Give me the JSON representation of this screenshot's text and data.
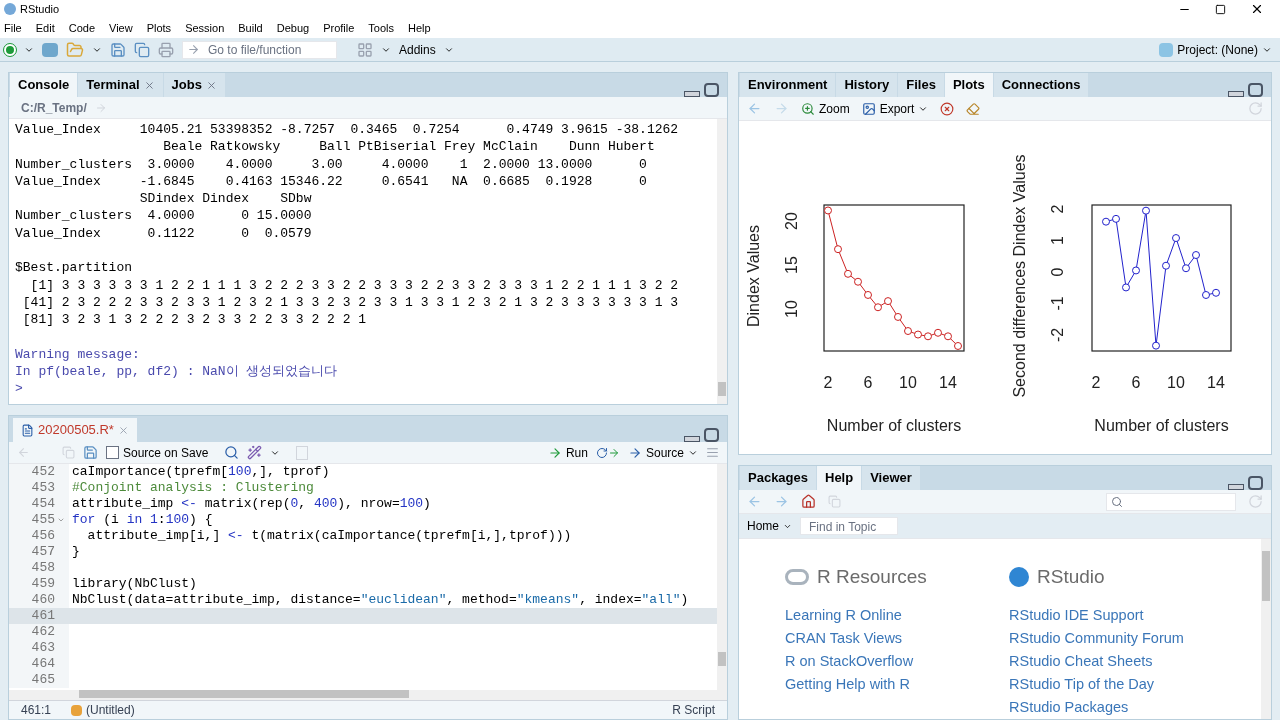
{
  "window": {
    "title": "RStudio"
  },
  "menu": [
    "File",
    "Edit",
    "Code",
    "View",
    "Plots",
    "Session",
    "Build",
    "Debug",
    "Profile",
    "Tools",
    "Help"
  ],
  "toolbar": {
    "goto_placeholder": "Go to file/function",
    "addins": "Addins",
    "project": "Project: (None)"
  },
  "console": {
    "tabs": [
      {
        "label": "Console",
        "selected": true,
        "closable": false
      },
      {
        "label": "Terminal",
        "selected": false,
        "closable": true
      },
      {
        "label": "Jobs",
        "selected": false,
        "closable": true
      }
    ],
    "path": "C:/R_Temp/",
    "lines": [
      {
        "kind": "output",
        "text": "Value_Index     10405.21 53398352 -8.7257  0.3465  0.7254      0.4749 3.9615 -38.1262"
      },
      {
        "kind": "output",
        "text": "                   Beale Ratkowsky     Ball PtBiserial Frey McClain    Dunn Hubert"
      },
      {
        "kind": "output",
        "text": "Number_clusters  3.0000    4.0000     3.00     4.0000    1  2.0000 13.0000      0"
      },
      {
        "kind": "output",
        "text": "Value_Index     -1.6845    0.4163 15346.22     0.6541   NA  0.6685  0.1928      0"
      },
      {
        "kind": "output",
        "text": "                SDindex Dindex    SDbw"
      },
      {
        "kind": "output",
        "text": "Number_clusters  4.0000      0 15.0000"
      },
      {
        "kind": "output",
        "text": "Value_Index      0.1122      0  0.0579"
      },
      {
        "kind": "blank"
      },
      {
        "kind": "output",
        "text": "$Best.partition"
      },
      {
        "kind": "output",
        "text": "  [1] 3 3 3 3 3 3 1 2 2 1 1 1 3 2 2 2 3 3 2 2 3 3 3 2 2 3 3 2 3 3 3 1 2 2 1 1 1 3 2 2"
      },
      {
        "kind": "output",
        "text": " [41] 2 3 2 2 2 3 3 2 3 3 1 2 3 2 1 3 3 2 3 2 3 3 1 3 3 1 2 3 2 1 3 2 3 3 3 3 3 3 1 3"
      },
      {
        "kind": "output",
        "text": " [81] 3 2 3 1 3 2 2 2 3 2 3 3 2 2 3 3 2 2 2 1"
      },
      {
        "kind": "blank"
      },
      {
        "kind": "warning",
        "text": "Warning message:"
      },
      {
        "kind": "warning",
        "text": "In pf(beale, pp, df2) : NaN이 생성되었습니다"
      },
      {
        "kind": "prompt",
        "text": ">"
      }
    ]
  },
  "editor": {
    "tabs": [
      {
        "label": "20200505.R*",
        "selected": true,
        "closable": true
      }
    ],
    "source_on_save": {
      "label": "Source on Save",
      "checked": false
    },
    "run": "Run",
    "source": "Source",
    "lines": [
      {
        "number": "452",
        "fold": false,
        "current": false,
        "tokens": [
          {
            "kind": "plain",
            "text": "caImportance(tprefm["
          },
          {
            "kind": "number",
            "text": "100"
          },
          {
            "kind": "plain",
            "text": ",], tprof)"
          }
        ]
      },
      {
        "number": "453",
        "fold": false,
        "current": false,
        "tokens": [
          {
            "kind": "comment",
            "text": "#Conjoint analysis : Clustering"
          }
        ]
      },
      {
        "number": "454",
        "fold": false,
        "current": false,
        "tokens": [
          {
            "kind": "plain",
            "text": "attribute_imp "
          },
          {
            "kind": "keyword",
            "text": "<-"
          },
          {
            "kind": "plain",
            "text": " matrix(rep("
          },
          {
            "kind": "number",
            "text": "0"
          },
          {
            "kind": "plain",
            "text": ", "
          },
          {
            "kind": "number",
            "text": "400"
          },
          {
            "kind": "plain",
            "text": "), nrow="
          },
          {
            "kind": "number",
            "text": "100"
          },
          {
            "kind": "plain",
            "text": ")"
          }
        ]
      },
      {
        "number": "455",
        "fold": true,
        "current": false,
        "tokens": [
          {
            "kind": "keyword",
            "text": "for"
          },
          {
            "kind": "plain",
            "text": " (i "
          },
          {
            "kind": "keyword",
            "text": "in"
          },
          {
            "kind": "number",
            "text": " 1"
          },
          {
            "kind": "plain",
            "text": ":"
          },
          {
            "kind": "number",
            "text": "100"
          },
          {
            "kind": "plain",
            "text": ") {"
          }
        ]
      },
      {
        "number": "456",
        "fold": false,
        "current": false,
        "tokens": [
          {
            "kind": "plain",
            "text": "  attribute_imp[i,] "
          },
          {
            "kind": "keyword",
            "text": "<-"
          },
          {
            "kind": "plain",
            "text": " t(matrix(caImportance(tprefm[i,],tprof)))"
          }
        ]
      },
      {
        "number": "457",
        "fold": false,
        "current": false,
        "tokens": [
          {
            "kind": "plain",
            "text": "}"
          }
        ]
      },
      {
        "number": "458",
        "fold": false,
        "current": false
      },
      {
        "number": "459",
        "fold": false,
        "current": false,
        "tokens": [
          {
            "kind": "plain",
            "text": "library(NbClust)"
          }
        ]
      },
      {
        "number": "460",
        "fold": false,
        "current": false,
        "tokens": [
          {
            "kind": "plain",
            "text": "NbClust(data=attribute_imp, distance="
          },
          {
            "kind": "string",
            "text": "\"euclidean\""
          },
          {
            "kind": "plain",
            "text": ", method="
          },
          {
            "kind": "string",
            "text": "\"kmeans\""
          },
          {
            "kind": "plain",
            "text": ", index="
          },
          {
            "kind": "string",
            "text": "\"all\""
          },
          {
            "kind": "plain",
            "text": ")"
          }
        ]
      },
      {
        "number": "461",
        "fold": false,
        "current": true
      },
      {
        "number": "462",
        "fold": false,
        "current": false
      },
      {
        "number": "463",
        "fold": false,
        "current": false
      },
      {
        "number": "464",
        "fold": false,
        "current": false
      },
      {
        "number": "465",
        "fold": false,
        "current": false
      }
    ],
    "status": {
      "position": "461:1",
      "scope": "(Untitled)",
      "file_type": "R Script"
    }
  },
  "plots_pane": {
    "tabs": [
      {
        "label": "Environment",
        "selected": false
      },
      {
        "label": "History",
        "selected": false
      },
      {
        "label": "Files",
        "selected": false
      },
      {
        "label": "Plots",
        "selected": true
      },
      {
        "label": "Connections",
        "selected": false
      }
    ],
    "zoom": "Zoom",
    "export": "Export",
    "charts": [
      {
        "chart_data": {
          "type": "line",
          "xlabel": "Number of clusters",
          "ylabel": "Dindex Values",
          "x": [
            2,
            3,
            4,
            5,
            6,
            7,
            8,
            9,
            10,
            11,
            12,
            13,
            14,
            15
          ],
          "series": [
            {
              "color": "#cc2222",
              "marker": "circle",
              "values": [
                21.2,
                16.8,
                14.0,
                13.1,
                11.6,
                10.2,
                10.9,
                9.1,
                7.5,
                7.1,
                6.9,
                7.3,
                6.9,
                5.8
              ]
            }
          ],
          "xlim": [
            1.6,
            15.6
          ],
          "ylim": [
            5.23,
            21.82
          ],
          "xticks": [
            2,
            6,
            10,
            14
          ],
          "yticks": [
            10,
            15,
            20
          ]
        }
      },
      {
        "chart_data": {
          "type": "line",
          "xlabel": "Number of clusters",
          "ylabel": "Second differences Dindex Values",
          "x": [
            3,
            4,
            5,
            6,
            7,
            8,
            9,
            10,
            11,
            12,
            13,
            14
          ],
          "series": [
            {
              "color": "#2222cc",
              "marker": "circle",
              "values": [
                1.6,
                1.69,
                -0.49,
                0.05,
                1.95,
                -2.34,
                0.2,
                1.08,
                0.12,
                0.54,
                -0.73,
                -0.66
              ]
            }
          ],
          "xlim": [
            1.6,
            15.5
          ],
          "ylim": [
            -2.51,
            2.13
          ],
          "xticks": [
            2,
            6,
            10,
            14
          ],
          "yticks": [
            -2,
            -1,
            0,
            1,
            2
          ]
        }
      }
    ]
  },
  "help_pane": {
    "tabs": [
      {
        "label": "Packages",
        "selected": false
      },
      {
        "label": "Help",
        "selected": true
      },
      {
        "label": "Viewer",
        "selected": false
      }
    ],
    "home": "Home",
    "find_placeholder": "Find in Topic",
    "columns": [
      {
        "heading": "R Resources",
        "kind": "r",
        "links": [
          "Learning R Online",
          "CRAN Task Views",
          "R on StackOverflow",
          "Getting Help with R"
        ]
      },
      {
        "heading": "RStudio",
        "kind": "rstudio",
        "links": [
          "RStudio IDE Support",
          "RStudio Community Forum",
          "RStudio Cheat Sheets",
          "RStudio Tip of the Day",
          "RStudio Packages"
        ]
      }
    ]
  }
}
